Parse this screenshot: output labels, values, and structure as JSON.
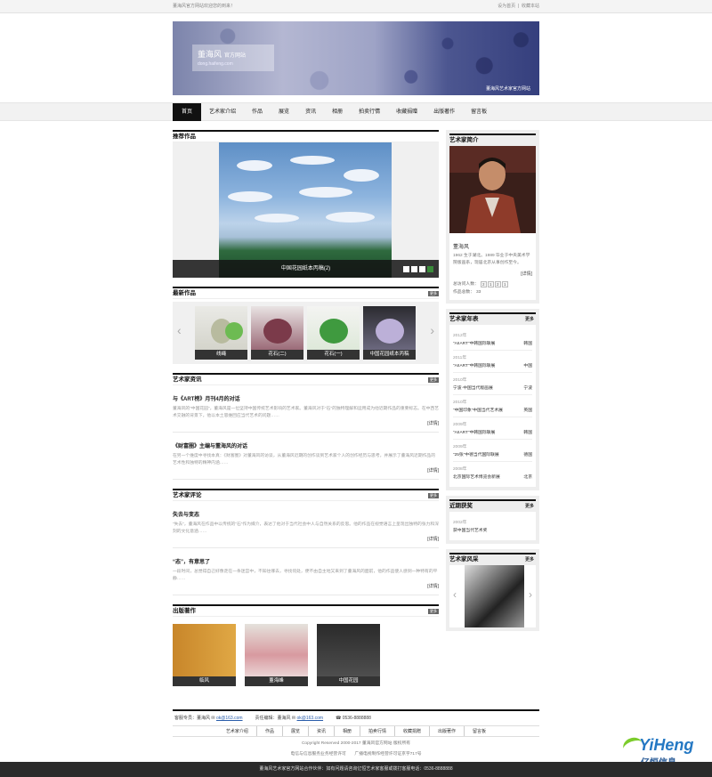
{
  "topbar": {
    "welcome": "董海风官方网站欢迎您的到来！",
    "set_home": "设为首页",
    "bookmark": "收藏本站"
  },
  "banner": {
    "title": "董海风",
    "subtitle": "官方网站",
    "url": "dong.haifeng.com",
    "tagline": "董海风艺术家官方网站"
  },
  "nav": [
    "首页",
    "艺术家介绍",
    "作品",
    "展览",
    "资讯",
    "相册",
    "拍卖行情",
    "收藏捐赠",
    "出版著作",
    "留言板"
  ],
  "featured": {
    "heading": "推荐作品",
    "caption": "中国花园纸本丙稿(2)",
    "slides": 4,
    "active_slide": 3
  },
  "latest": {
    "heading": "最新作品",
    "more": "更多",
    "items": [
      "线绳",
      "花石(二)",
      "花石(一)",
      "中国花园纸本丙稿"
    ]
  },
  "news": {
    "heading": "艺术家资讯",
    "more": "更多",
    "read_more": "[详情]",
    "items": [
      {
        "title": "与《ART榜》月刊4月的对话",
        "desc": "董海风的“中国花园”，董海风是一位坚持中国传统艺术影响的艺术家。董海风对于“石”的独特理解和运用成为他近期作品的重要标志。在中西艺术交融的背景下，他以本土思维回应当代艺术的问题……"
      },
      {
        "title": "《财富圈》主编与董海风的对话",
        "desc": "在另一个维度中寻找本真：《财富圈》对董海风的访谈，从董海风近期的创作谈到艺术家个人的创作经历与思考，并展示了董海风近期作品的艺术性和独特的精神内涵……"
      }
    ]
  },
  "reviews": {
    "heading": "艺术家评论",
    "more": "更多",
    "read_more": "[详情]",
    "items": [
      {
        "title": "失去与变态",
        "desc": "“失去”，董海风在作品中以传统的“石”作为媒介，表达了他对于当代社会中人与自然关系的反思。他的作品在视觉语言上呈现出独特的张力和深刻的文化意涵……"
      },
      {
        "title": "“态”，有意思了",
        "desc": "一段时间，总觉得自己好像走在一条迷宫中，不知往哪去，寻找何处，便不由自主地又来到了董海风的面前，他的作品使人感到一种特有的平静……"
      }
    ]
  },
  "publications": {
    "heading": "出版著作",
    "more": "更多",
    "items": [
      "临风",
      "董海峰",
      "中国花园"
    ]
  },
  "artist": {
    "heading": "艺术家简介",
    "name": "董海风",
    "bio": "1962 生于湖北。1989 毕业于中央美术学院版画系，现居北京从事创作至今。",
    "read_more": "[详情]",
    "visits_label": "总访问人数：",
    "visits": [
      "2",
      "1",
      "2",
      "1"
    ],
    "works_label": "作品总数：",
    "works": "33"
  },
  "timeline": {
    "heading": "艺术家年表",
    "more": "更多",
    "items": [
      {
        "year": "2012年",
        "event": "“AIIART”中韩国际联展",
        "place": "韩国"
      },
      {
        "year": "2011年",
        "event": "“AIIART”中韩国际联展",
        "place": "中国"
      },
      {
        "year": "2010年",
        "event": "宁波·中国当代版画展",
        "place": "宁波"
      },
      {
        "year": "2010年",
        "event": "“中国印象”中国当代艺术展",
        "place": "英国"
      },
      {
        "year": "2009年",
        "event": "“AIIART”中韩国际联展",
        "place": "韩国"
      },
      {
        "year": "2009年",
        "event": "“25张”中德当代国际联展",
        "place": "德国"
      },
      {
        "year": "2008年",
        "event": "北京国际艺术博览会新展",
        "place": "北京"
      }
    ]
  },
  "awards": {
    "heading": "近期获奖",
    "more": "更多",
    "year": "2002年",
    "title": "获中国当代艺术奖"
  },
  "style": {
    "heading": "艺术家风采",
    "more": "更多"
  },
  "footer": {
    "contact": [
      {
        "label": "客服专员：董海风",
        "email": "ok@163.com"
      },
      {
        "label": "责任编辑：董海风",
        "email": "ok@163.com"
      }
    ],
    "phone": "0536-8888888",
    "links": [
      "艺术家介绍",
      "作品",
      "展览",
      "资讯",
      "相册",
      "拍卖行情",
      "收藏捐赠",
      "出版著作",
      "留言板"
    ],
    "copyright": "Copyright Reserved 2000-2017 董海风官方网站 版权所有",
    "icp": "电信与信息服务业务经营许可　　广播电视制作经营许可证京字717号",
    "bottom_bar": "董海风艺术家官方网站合作伙伴：如有问题请咨询亿恒艺术家客服或拨打客服电话：0536-8888888",
    "brand": "YiHeng",
    "brand_cn": "亿恒信息"
  },
  "colors": {
    "nav_active": "#111111",
    "link": "#2a5daa",
    "brand_blue": "#2478c3",
    "brand_green": "#6bbd2f"
  }
}
